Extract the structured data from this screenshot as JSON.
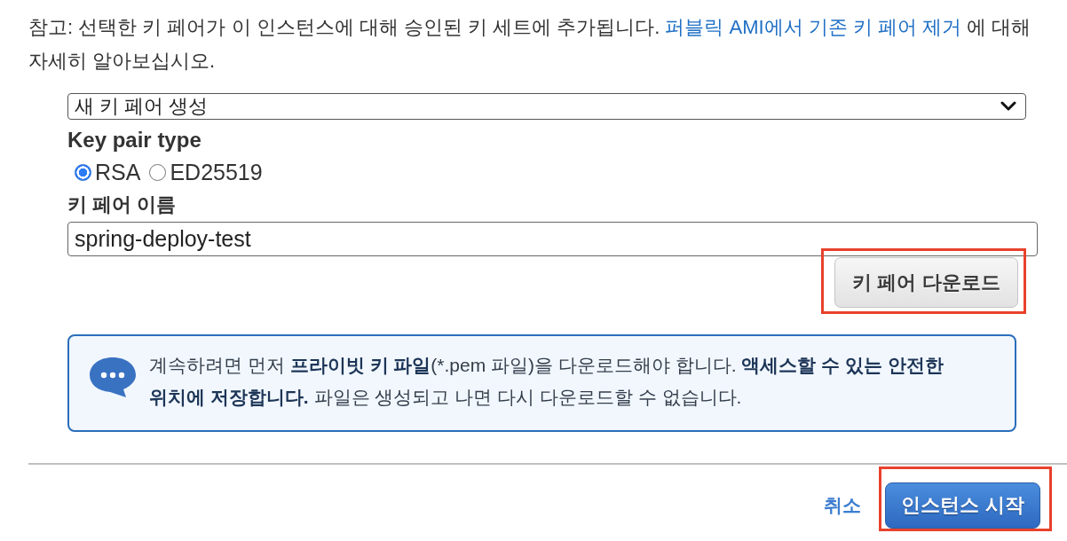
{
  "note": [
    {
      "kind": "text",
      "text": "참고: 선택한 키 페어가 이 인스턴스에 대해 승인된 키 세트에 추가됩니다. "
    },
    {
      "kind": "link",
      "text": "퍼블릭 AMI에서 기존 키 페어 제거"
    },
    {
      "kind": "text",
      "text": " 에 대해 자세히 알아보십시오."
    }
  ],
  "key_pair_select": {
    "value": "새 키 페어 생성"
  },
  "key_pair_type": {
    "label": "Key pair type",
    "options": [
      {
        "label": "RSA",
        "selected": true
      },
      {
        "label": "ED25519",
        "selected": false
      }
    ]
  },
  "key_pair_name": {
    "label": "키 페어 이름",
    "value": "spring-deploy-test"
  },
  "download_button": {
    "label": "키 페어 다운로드",
    "highlighted": true
  },
  "info_message": [
    {
      "bold": false,
      "text": "계속하려면 먼저 "
    },
    {
      "bold": true,
      "text": "프라이빗 키 파일"
    },
    {
      "bold": false,
      "text": "(*.pem 파일)을 다운로드해야 합니다. "
    },
    {
      "bold": true,
      "text": "액세스할 수 있는 안전한 위치에 저장합니다."
    },
    {
      "bold": false,
      "text": " 파일은 생성되고 나면 다시 다운로드할 수 없습니다."
    }
  ],
  "footer": {
    "cancel_link": "취소",
    "launch_button": {
      "label": "인스턴스 시작",
      "highlighted": true
    }
  }
}
